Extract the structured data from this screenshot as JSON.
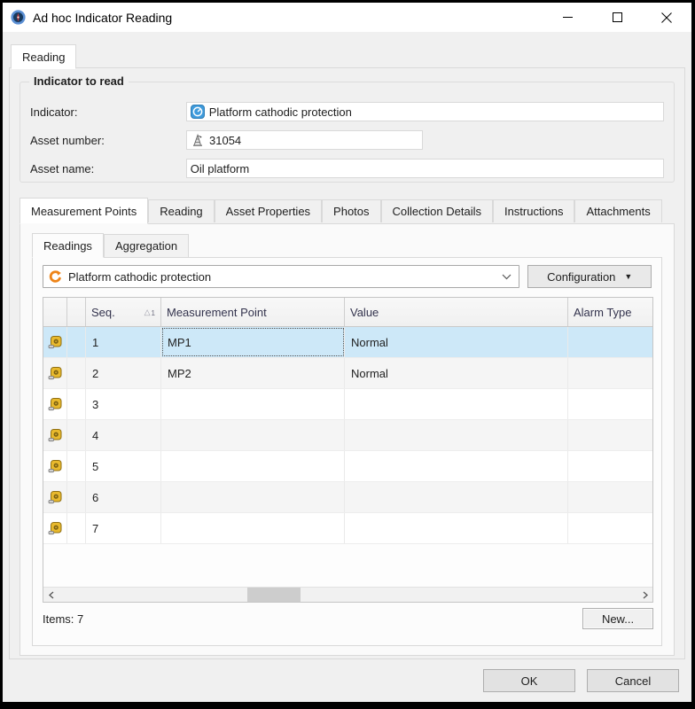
{
  "window": {
    "title": "Ad hoc Indicator Reading"
  },
  "colors": {
    "selection_blue": "#cde8f8",
    "accent_orange": "#ee8418",
    "dialog_bg": "#f0f0f0",
    "titlebar_bg": "#ffffff",
    "header_text": "#33334d"
  },
  "outer_tabs": {
    "items": [
      {
        "label": "Reading"
      }
    ]
  },
  "indicator_group": {
    "title": "Indicator to read",
    "indicator": {
      "label": "Indicator:",
      "value": "Platform cathodic protection"
    },
    "asset_number": {
      "label": "Asset number:",
      "value": "31054"
    },
    "asset_name": {
      "label": "Asset name:",
      "value": "Oil platform"
    }
  },
  "main_tabs": {
    "items": [
      {
        "label": "Measurement Points"
      },
      {
        "label": "Reading"
      },
      {
        "label": "Asset Properties"
      },
      {
        "label": "Photos"
      },
      {
        "label": "Collection Details"
      },
      {
        "label": "Instructions"
      },
      {
        "label": "Attachments"
      }
    ]
  },
  "sub_tabs": {
    "items": [
      {
        "label": "Readings"
      },
      {
        "label": "Aggregation"
      }
    ]
  },
  "selector": {
    "value": "Platform cathodic protection",
    "config_button_label": "Configuration"
  },
  "grid": {
    "columns": {
      "seq": "Seq.",
      "measurement_point": "Measurement Point",
      "value": "Value",
      "alarm_type": "Alarm Type"
    },
    "sort": {
      "glyph": "△",
      "order": "1"
    },
    "rows": [
      {
        "seq": "1",
        "measurement_point": "MP1",
        "value": "Normal",
        "alarm_type": ""
      },
      {
        "seq": "2",
        "measurement_point": "MP2",
        "value": "Normal",
        "alarm_type": ""
      },
      {
        "seq": "3",
        "measurement_point": "",
        "value": "",
        "alarm_type": ""
      },
      {
        "seq": "4",
        "measurement_point": "",
        "value": "",
        "alarm_type": ""
      },
      {
        "seq": "5",
        "measurement_point": "",
        "value": "",
        "alarm_type": ""
      },
      {
        "seq": "6",
        "measurement_point": "",
        "value": "",
        "alarm_type": ""
      },
      {
        "seq": "7",
        "measurement_point": "",
        "value": "",
        "alarm_type": ""
      }
    ],
    "items_count_label": "Items: 7"
  },
  "buttons": {
    "new": "New...",
    "ok": "OK",
    "cancel": "Cancel"
  }
}
